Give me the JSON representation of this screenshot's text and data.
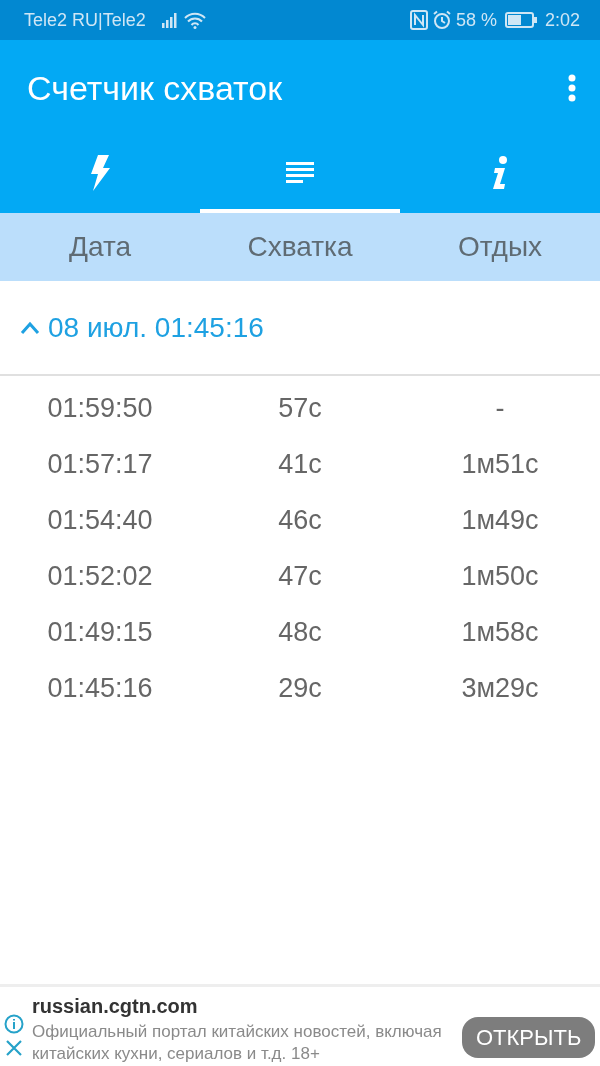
{
  "status_bar": {
    "carrier": "Tele2 RU|Tele2",
    "battery_percent": "58 %",
    "time": "2:02"
  },
  "app_bar": {
    "title": "Счетчик схваток"
  },
  "tabs": [
    {
      "kind": "bolt",
      "selected": false
    },
    {
      "kind": "list",
      "selected": true
    },
    {
      "kind": "info",
      "selected": false
    }
  ],
  "table": {
    "columns": [
      "Дата",
      "Схватка",
      "Отдых"
    ],
    "group": {
      "label": "08 июл. 01:45:16",
      "expanded": true
    },
    "rows": [
      [
        "01:59:50",
        "57с",
        "-"
      ],
      [
        "01:57:17",
        "41с",
        "1м51с"
      ],
      [
        "01:54:40",
        "46с",
        "1м49с"
      ],
      [
        "01:52:02",
        "47с",
        "1м50с"
      ],
      [
        "01:49:15",
        "48с",
        "1м58с"
      ],
      [
        "01:45:16",
        "29с",
        "3м29с"
      ]
    ]
  },
  "ad": {
    "domain": "russian.cgtn.com",
    "text": "Официальный портал китайских новостей, включая китайских кухни, сериалов и т.д. 18+",
    "button": "ОТКРЫТЬ"
  }
}
